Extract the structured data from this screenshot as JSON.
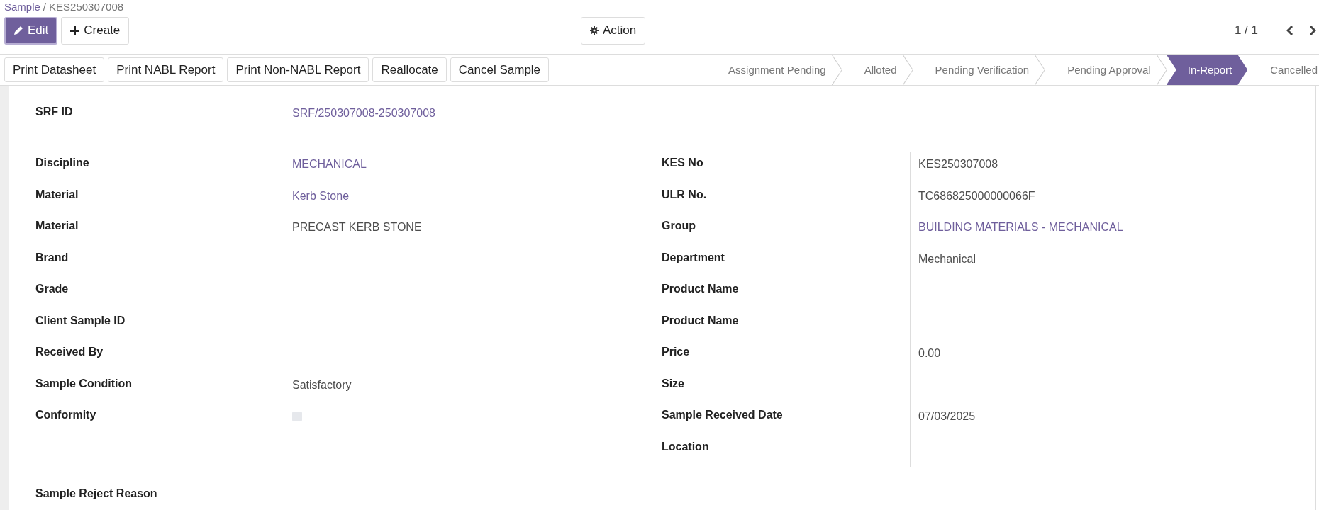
{
  "breadcrumb": {
    "parent": "Sample",
    "separator": "/",
    "current": "KES250307008"
  },
  "toolbar": {
    "buttons": [
      {
        "label": "Edit",
        "kind": "edit"
      },
      {
        "label": "Create",
        "kind": "create"
      }
    ],
    "action": {
      "label": "Action"
    },
    "pager": {
      "text": "1 / 1"
    }
  },
  "header_buttons": [
    "Print Datasheet",
    "Print NABL Report",
    "Print Non-NABL Report",
    "Reallocate",
    "Cancel Sample"
  ],
  "stages": [
    {
      "label": "Assignment Pending",
      "selected": false
    },
    {
      "label": "Alloted",
      "selected": false
    },
    {
      "label": "Pending Verification",
      "selected": false
    },
    {
      "label": "Pending Approval",
      "selected": false
    },
    {
      "label": "In-Report",
      "selected": true
    },
    {
      "label": "Cancelled",
      "selected": false
    }
  ],
  "srf": {
    "label": "SRF ID",
    "value": "SRF/250307008-250307008",
    "kind": "link"
  },
  "left_fields": [
    {
      "label": "Discipline",
      "value": "MECHANICAL",
      "kind": "link"
    },
    {
      "label": "Material",
      "value": "Kerb Stone",
      "kind": "link"
    },
    {
      "label": "Material",
      "value": "PRECAST KERB STONE",
      "kind": "text"
    },
    {
      "label": "Brand",
      "kind": "empty"
    },
    {
      "label": "Grade",
      "kind": "empty"
    },
    {
      "label": "Client Sample ID",
      "kind": "empty"
    },
    {
      "label": "Received By",
      "kind": "empty"
    },
    {
      "label": "Sample Condition",
      "value": "Satisfactory",
      "kind": "text"
    },
    {
      "label": "Conformity",
      "kind": "checkbox",
      "checked": false
    }
  ],
  "right_fields": [
    {
      "label": "KES No",
      "value": "KES250307008",
      "kind": "text"
    },
    {
      "label": "ULR No.",
      "value": "TC686825000000066F",
      "kind": "text"
    },
    {
      "label": "Group",
      "value": "BUILDING MATERIALS - MECHANICAL",
      "kind": "link"
    },
    {
      "label": "Department",
      "value": "Mechanical",
      "kind": "text"
    },
    {
      "label": "Product Name",
      "kind": "empty"
    },
    {
      "label": "Product Name",
      "kind": "empty"
    },
    {
      "label": "Price",
      "value": "0.00",
      "kind": "text"
    },
    {
      "label": "Size",
      "kind": "empty"
    },
    {
      "label": "Sample Received Date",
      "value": "07/03/2025",
      "kind": "text"
    },
    {
      "label": "Location",
      "kind": "empty"
    }
  ],
  "reject_reason": {
    "label": "Sample Reject Reason"
  }
}
